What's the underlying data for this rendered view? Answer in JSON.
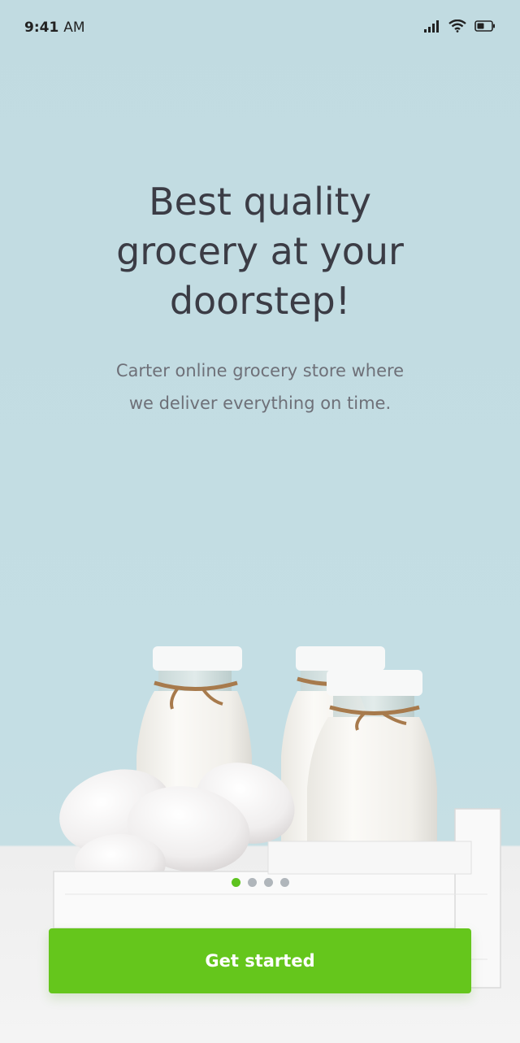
{
  "status_bar": {
    "time": "9:41",
    "ampm": "AM",
    "icons": [
      "signal-icon",
      "wifi-icon",
      "battery-icon"
    ]
  },
  "onboarding": {
    "headline_line1": "Best quality",
    "headline_line2": "grocery at your",
    "headline_line3": "doorstep!",
    "description_line1": "Carter online grocery store where",
    "description_line2": "we deliver everything on time.",
    "pages_total": 4,
    "current_page": 1
  },
  "cta": {
    "label": "Get started"
  },
  "colors": {
    "background": "#c2dce2",
    "accent": "#65c61c",
    "headline": "#3b3c45",
    "body_text": "#6e7078",
    "dot_inactive": "#b0b6bb"
  }
}
